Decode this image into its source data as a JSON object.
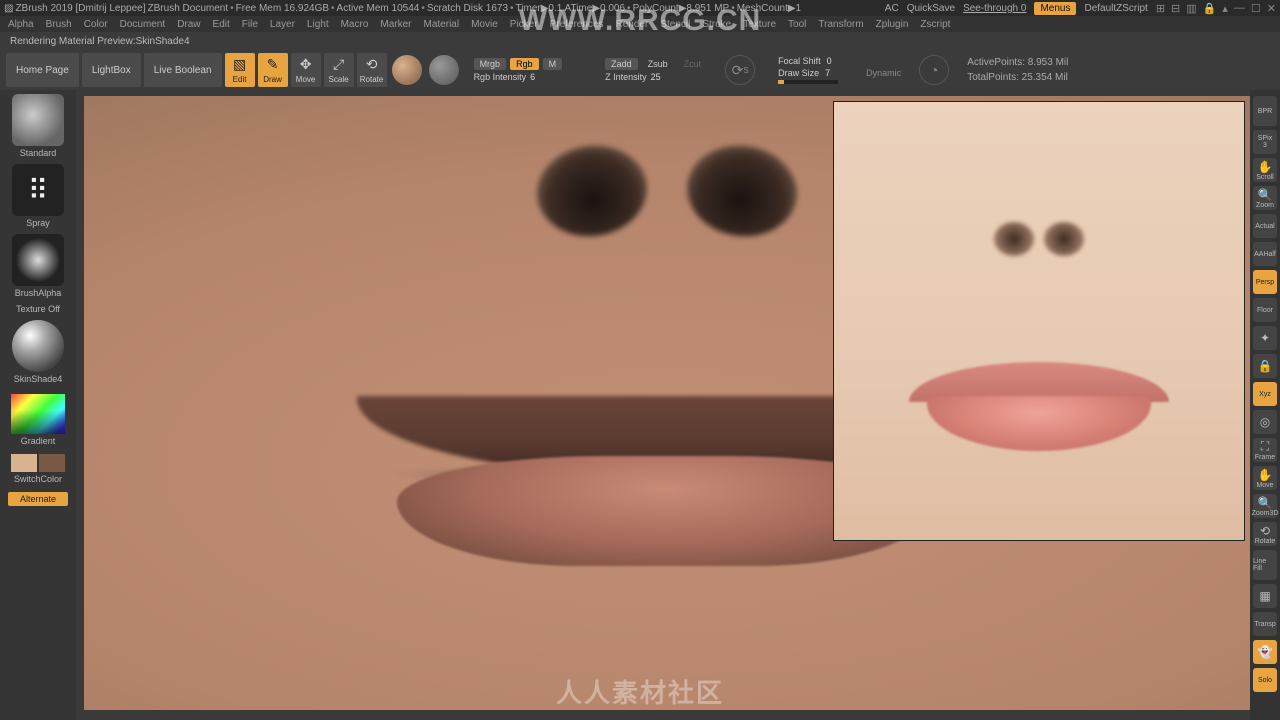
{
  "title": {
    "app": "ZBrush 2019 [Dmitrij Leppee]",
    "doc": "ZBrush Document",
    "stats": [
      "Free Mem 16.924GB",
      "Active Mem 10544",
      "Scratch Disk 1673",
      "Timer▶0.1 ATime▶0.006",
      "PolyCount▶8.951 MP",
      "MeshCount▶1"
    ],
    "right": {
      "ac": "AC",
      "quicksave": "QuickSave",
      "seethrough": "See-through  0",
      "menus": "Menus",
      "defscript": "DefaultZScript"
    }
  },
  "menu": [
    "Alpha",
    "Brush",
    "Color",
    "Document",
    "Draw",
    "Edit",
    "File",
    "Layer",
    "Light",
    "Macro",
    "Marker",
    "Material",
    "Movie",
    "Picker",
    "Preferences",
    "Render",
    "Stencil",
    "Stroke",
    "Texture",
    "Tool",
    "Transform",
    "Zplugin",
    "Zscript"
  ],
  "status": "Rendering Material Preview:SkinShade4",
  "toolbar": {
    "home": "Home Page",
    "lightbox": "LightBox",
    "liveboolean": "Live Boolean",
    "edit": "Edit",
    "draw": "Draw",
    "move": "Move",
    "scale": "Scale",
    "rotate": "Rotate",
    "mrgb": "Mrgb",
    "rgb": "Rgb",
    "m": "M",
    "rgb_intensity_lbl": "Rgb Intensity",
    "rgb_intensity_val": "6",
    "zadd": "Zadd",
    "zsub": "Zsub",
    "zcut": "Zcut",
    "zintensity_lbl": "Z Intensity",
    "zintensity_val": "25",
    "focal_lbl": "Focal Shift",
    "focal_val": "0",
    "drawsize_lbl": "Draw Size",
    "drawsize_val": "7",
    "dynamic": "Dynamic",
    "activepts": "ActivePoints: 8.953 Mil",
    "totalpts": "TotalPoints: 25.354 Mil"
  },
  "left": {
    "brush": "Standard",
    "stroke": "Spray",
    "alpha": "BrushAlpha",
    "texture": "Texture Off",
    "material": "SkinShade4",
    "gradient": "Gradient",
    "switchcolor": "SwitchColor",
    "alternate": "Alternate"
  },
  "right": {
    "bpr": "BPR",
    "spix_lbl": "SPix",
    "spix_val": "3",
    "scroll": "Scroll",
    "zoom": "Zoom",
    "actual": "Actual",
    "aahalf": "AAHalf",
    "persp": "Persp",
    "floor": "Floor",
    "local": "Local",
    "lock": "Lock",
    "xyz": "Xyz",
    "frame": "Frame",
    "move": "Move",
    "zoom3d": "Zoom3D",
    "rotate": "Rotate",
    "linefill": "Line Fill",
    "polyf": "PolyF",
    "transp": "Transp",
    "ghost": "Ghost",
    "solo": "Solo"
  },
  "watermark": {
    "top": "WWW.RRCG.CN",
    "bottom": "人人素材社区"
  }
}
